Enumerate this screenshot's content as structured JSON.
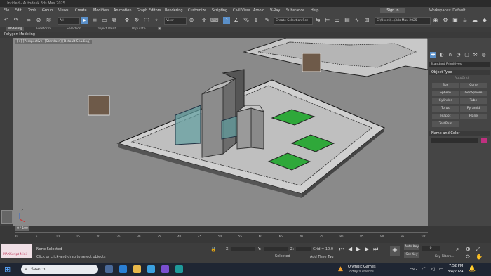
{
  "title": "Untitled - Autodesk 3ds Max 2025",
  "menu": [
    "File",
    "Edit",
    "Tools",
    "Group",
    "Views",
    "Create",
    "Modifiers",
    "Animation",
    "Graph Editors",
    "Rendering",
    "Customize",
    "Scripting",
    "Civil View",
    "Arnold",
    "V-Ray",
    "Substance",
    "Help"
  ],
  "signin": "Sign In",
  "workspace": "Workspaces:  Default",
  "toolbar": {
    "filter": "All",
    "view": "View",
    "named_sel": "Create Selection Set",
    "project": "C:\\Users\\...\\3ds Max 2025"
  },
  "ribbon": [
    "Modeling",
    "Freeform",
    "Selection",
    "Object Paint",
    "Populate"
  ],
  "polygon_label": "Polygon Modeling",
  "viewport_label": "[+] [Perspective] [Standard] [Default Shading]",
  "panel": {
    "object_type": "Object Type",
    "autogrid": "AutoGrid",
    "objects": [
      "Box",
      "Cone",
      "Sphere",
      "GeoSphere",
      "Cylinder",
      "Tube",
      "Torus",
      "Pyramid",
      "Teapot",
      "Plane",
      "TextPlus"
    ],
    "name_color": "Name and Color",
    "category": "Standard Primitives"
  },
  "timeslider": "0 / 100",
  "ruler": [
    "0",
    "5",
    "10",
    "15",
    "20",
    "25",
    "30",
    "35",
    "40",
    "45",
    "50",
    "55",
    "60",
    "65",
    "70",
    "75",
    "80",
    "85",
    "90",
    "95",
    "100"
  ],
  "status": {
    "selected": "None Selected",
    "hint": "Click or click-and-drag to select objects",
    "maxscript": "MAXScript Mini",
    "x": "X:",
    "y": "Y:",
    "z": "Z:",
    "grid": "Grid = 10.0",
    "addtime": "Add Time Tag",
    "autokey": "Auto Key",
    "setkey": "Set Key",
    "selected_dd": "Selected",
    "key_filters": "Key Filters...",
    "frame": "0"
  },
  "taskbar": {
    "search": "Search",
    "news_title": "Olympic Games",
    "news_sub": "Today's events",
    "lang": "ENG",
    "time": "7:52 PM",
    "date": "8/4/2024"
  },
  "colors": {
    "viewport_bg": "#8a8a8a",
    "accent": "#5a8fc8",
    "green_pad": "#2fa83a",
    "glass": "#5f9ea0"
  }
}
